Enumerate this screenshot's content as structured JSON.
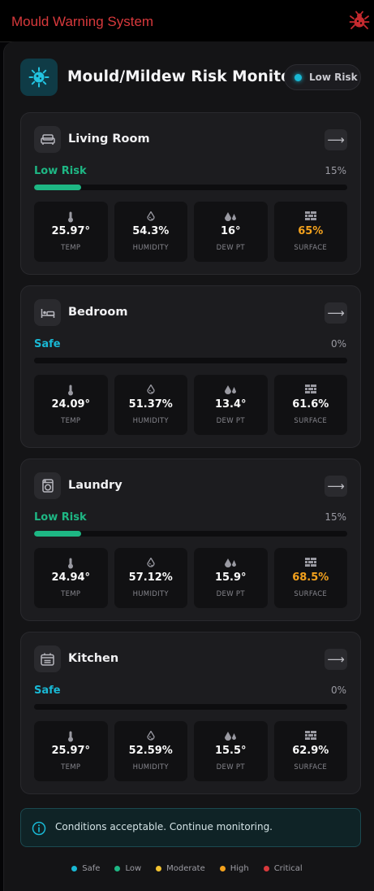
{
  "window": {
    "title": "Mould Warning System",
    "icon": "bug-icon"
  },
  "header": {
    "title": "Mould/Mildew Risk Monitor",
    "badge_label": "Low Risk",
    "icon": "virus-icon"
  },
  "rooms": [
    {
      "name": "Living Room",
      "icon": "sofa-icon",
      "status": "Low Risk",
      "status_color": "#1eb784",
      "risk_percent": "15%",
      "risk_value": 15,
      "temp": "25.97°",
      "humidity": "54.3%",
      "dew_point": "16°",
      "surface": "65%",
      "surface_warn": true
    },
    {
      "name": "Bedroom",
      "icon": "bed-icon",
      "status": "Safe",
      "status_color": "#19b8d4",
      "risk_percent": "0%",
      "risk_value": 0,
      "temp": "24.09°",
      "humidity": "51.37%",
      "dew_point": "13.4°",
      "surface": "61.6%",
      "surface_warn": false
    },
    {
      "name": "Laundry",
      "icon": "washing-machine-icon",
      "status": "Low Risk",
      "status_color": "#1eb784",
      "risk_percent": "15%",
      "risk_value": 15,
      "temp": "24.94°",
      "humidity": "57.12%",
      "dew_point": "15.9°",
      "surface": "68.5%",
      "surface_warn": true
    },
    {
      "name": "Kitchen",
      "icon": "stove-icon",
      "status": "Safe",
      "status_color": "#19b8d4",
      "risk_percent": "0%",
      "risk_value": 0,
      "temp": "25.97°",
      "humidity": "52.59%",
      "dew_point": "15.5°",
      "surface": "62.9%",
      "surface_warn": false
    }
  ],
  "metric_labels": {
    "temp": "TEMP",
    "humidity": "HUMIDITY",
    "dew_point": "DEW PT",
    "surface": "SURFACE"
  },
  "notice": {
    "text": "Conditions acceptable. Continue monitoring.",
    "icon": "info-icon"
  },
  "legend": [
    {
      "label": "Safe",
      "color": "#19b8d4"
    },
    {
      "label": "Low",
      "color": "#1eb784"
    },
    {
      "label": "Moderate",
      "color": "#f2c230"
    },
    {
      "label": "High",
      "color": "#f4a21d"
    },
    {
      "label": "Critical",
      "color": "#d8393c"
    }
  ],
  "colors": {
    "accent": "#19b8d4",
    "low": "#1eb784",
    "warn": "#f4a21d",
    "title_red": "#d8393c"
  }
}
